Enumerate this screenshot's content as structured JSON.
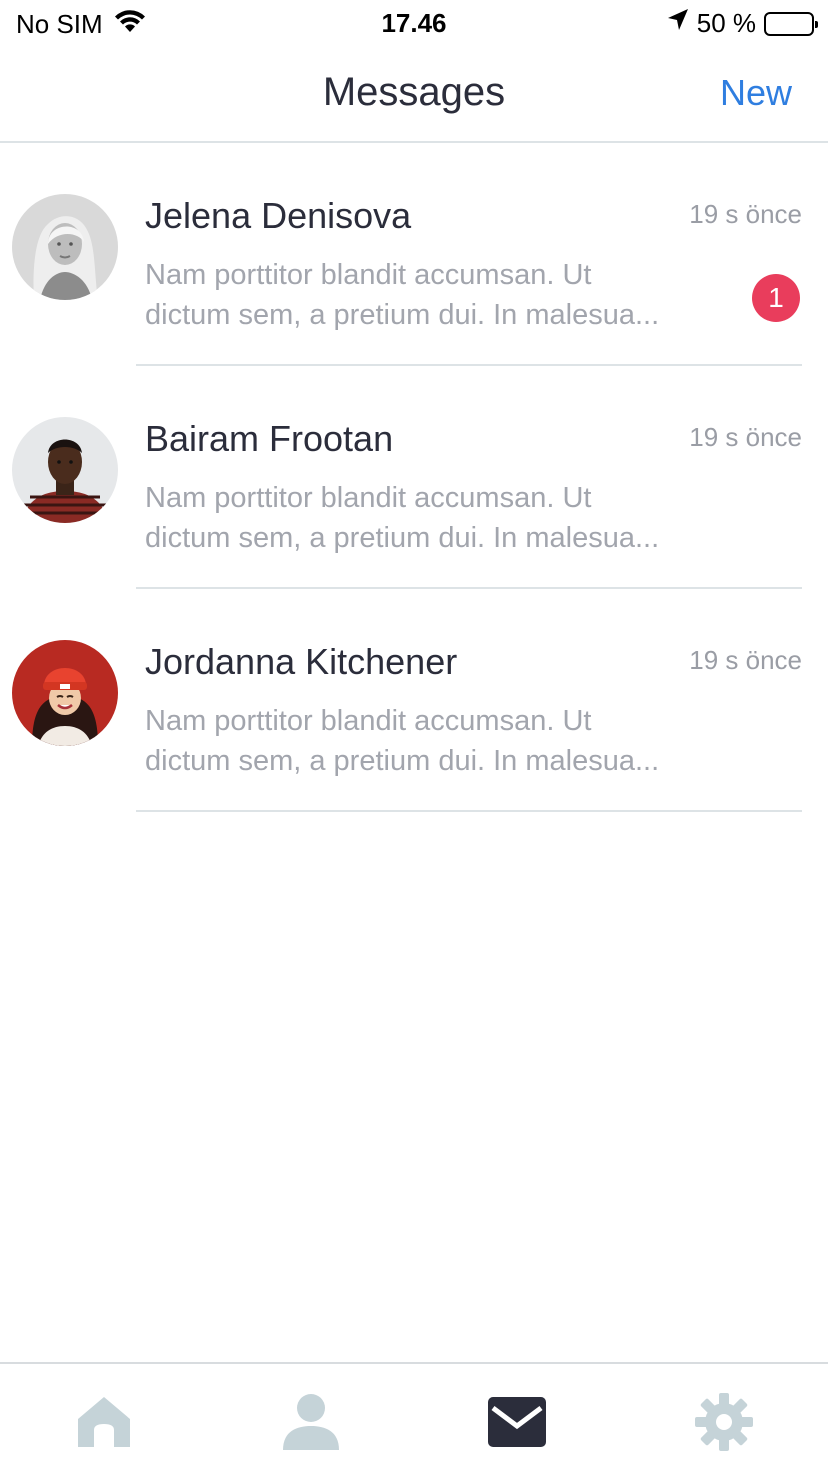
{
  "status_bar": {
    "carrier": "No SIM",
    "time": "17.46",
    "battery_text": "50 %",
    "battery_level": 0.5
  },
  "header": {
    "title": "Messages",
    "new_label": "New"
  },
  "messages": [
    {
      "name": "Jelena Denisova",
      "time": "19 s önce",
      "preview_line1": "Nam porttitor blandit accumsan. Ut",
      "preview_line2": "dictum sem, a pretium dui. In malesua...",
      "badge": "1"
    },
    {
      "name": "Bairam Frootan",
      "time": "19 s önce",
      "preview_line1": "Nam porttitor blandit accumsan. Ut",
      "preview_line2": "dictum sem, a pretium dui. In malesua..."
    },
    {
      "name": "Jordanna Kitchener",
      "time": "19 s önce",
      "preview_line1": "Nam porttitor blandit accumsan. Ut",
      "preview_line2": "dictum sem, a pretium dui. In malesua..."
    }
  ],
  "tabs": [
    {
      "icon": "home-icon",
      "active": false
    },
    {
      "icon": "user-icon",
      "active": false
    },
    {
      "icon": "mail-icon",
      "active": true
    },
    {
      "icon": "gear-icon",
      "active": false
    }
  ],
  "colors": {
    "accent": "#2f7ee0",
    "badge": "#e93d5c",
    "tab_active": "#2b2d3b",
    "tab_inactive": "#c5d3d8"
  }
}
